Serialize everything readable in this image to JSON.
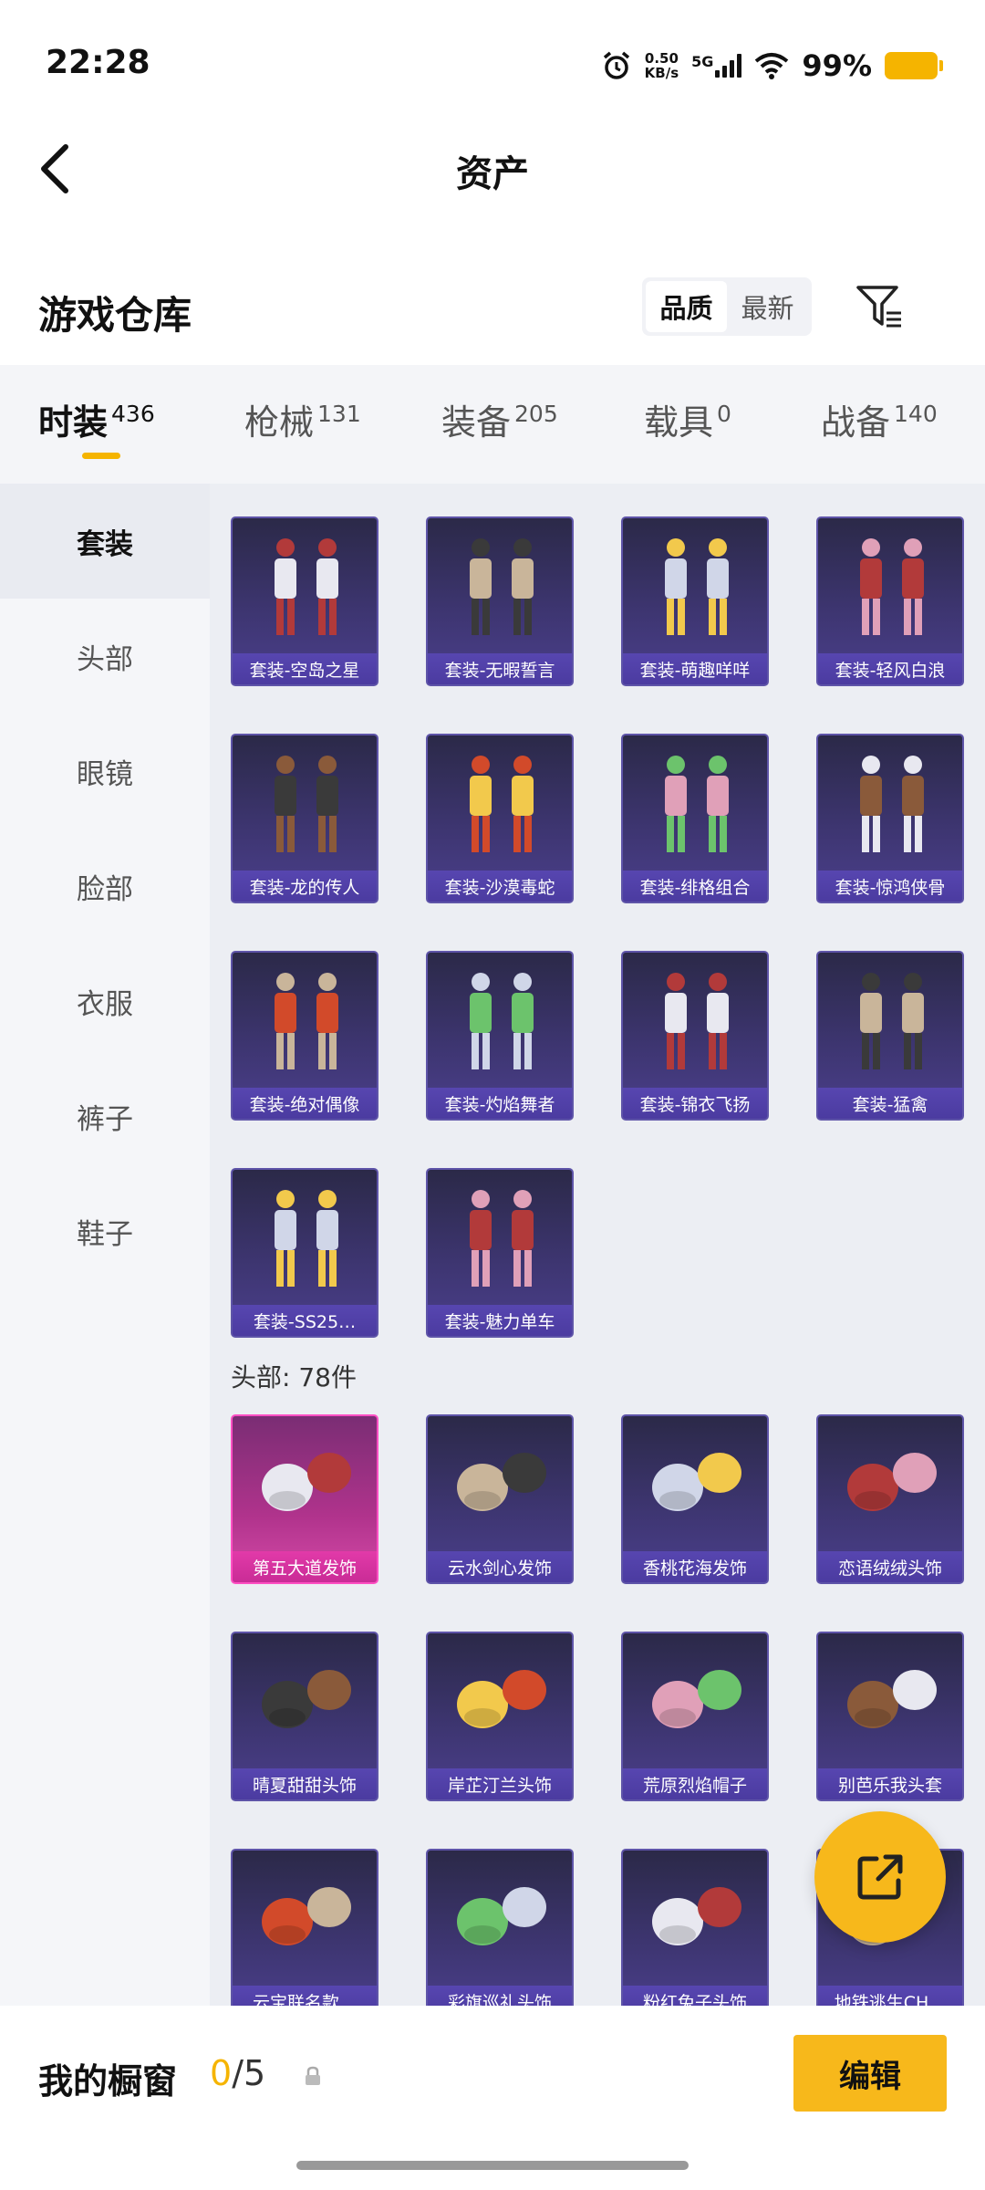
{
  "status_bar": {
    "time": "22:28",
    "net_speed": "0.50",
    "net_speed_unit": "KB/s",
    "network": "5G",
    "battery": "99%"
  },
  "header": {
    "title": "资产"
  },
  "section": {
    "title": "游戏仓库",
    "sort_options": [
      "品质",
      "最新"
    ],
    "active_sort": "品质"
  },
  "tabs": [
    {
      "label": "时装",
      "count": "436",
      "active": true
    },
    {
      "label": "枪械",
      "count": "131"
    },
    {
      "label": "装备",
      "count": "205"
    },
    {
      "label": "载具",
      "count": "0"
    },
    {
      "label": "战备",
      "count": "140"
    }
  ],
  "sidebar": {
    "items": [
      {
        "label": "套装",
        "active": true
      },
      {
        "label": "头部"
      },
      {
        "label": "眼镜"
      },
      {
        "label": "脸部"
      },
      {
        "label": "衣服"
      },
      {
        "label": "裤子"
      },
      {
        "label": "鞋子"
      }
    ]
  },
  "sets": [
    {
      "label": "套装-空岛之星"
    },
    {
      "label": "套装-无暇誓言"
    },
    {
      "label": "套装-萌趣咩咩"
    },
    {
      "label": "套装-轻风白浪"
    },
    {
      "label": "套装-龙的传人"
    },
    {
      "label": "套装-沙漠毒蛇"
    },
    {
      "label": "套装-绯格组合"
    },
    {
      "label": "套装-惊鸿侠骨"
    },
    {
      "label": "套装-绝对偶像"
    },
    {
      "label": "套装-灼焰舞者"
    },
    {
      "label": "套装-锦衣飞扬"
    },
    {
      "label": "套装-猛禽"
    },
    {
      "label": "套装-SS25…"
    },
    {
      "label": "套装-魅力单车"
    }
  ],
  "head_group": {
    "title": "头部: 78件"
  },
  "heads": [
    {
      "label": "第五大道发饰",
      "rarity": "pink"
    },
    {
      "label": "云水剑心发饰"
    },
    {
      "label": "香桃花海发饰"
    },
    {
      "label": "恋语绒绒头饰"
    },
    {
      "label": "晴夏甜甜头饰"
    },
    {
      "label": "岸芷汀兰头饰"
    },
    {
      "label": "荒原烈焰帽子"
    },
    {
      "label": "别芭乐我头套"
    },
    {
      "label": "云宝联名款…"
    },
    {
      "label": "彩旗巡礼头饰"
    },
    {
      "label": "粉红兔子头饰"
    },
    {
      "label": "地铁逃生CH…"
    }
  ],
  "bottom": {
    "window_label": "我的橱窗",
    "used": "0",
    "total": "/5",
    "edit_label": "编辑"
  },
  "colors": {
    "accent": "#f5b400",
    "card_purple": "#4b3f8c",
    "card_pink": "#d64aa8"
  }
}
